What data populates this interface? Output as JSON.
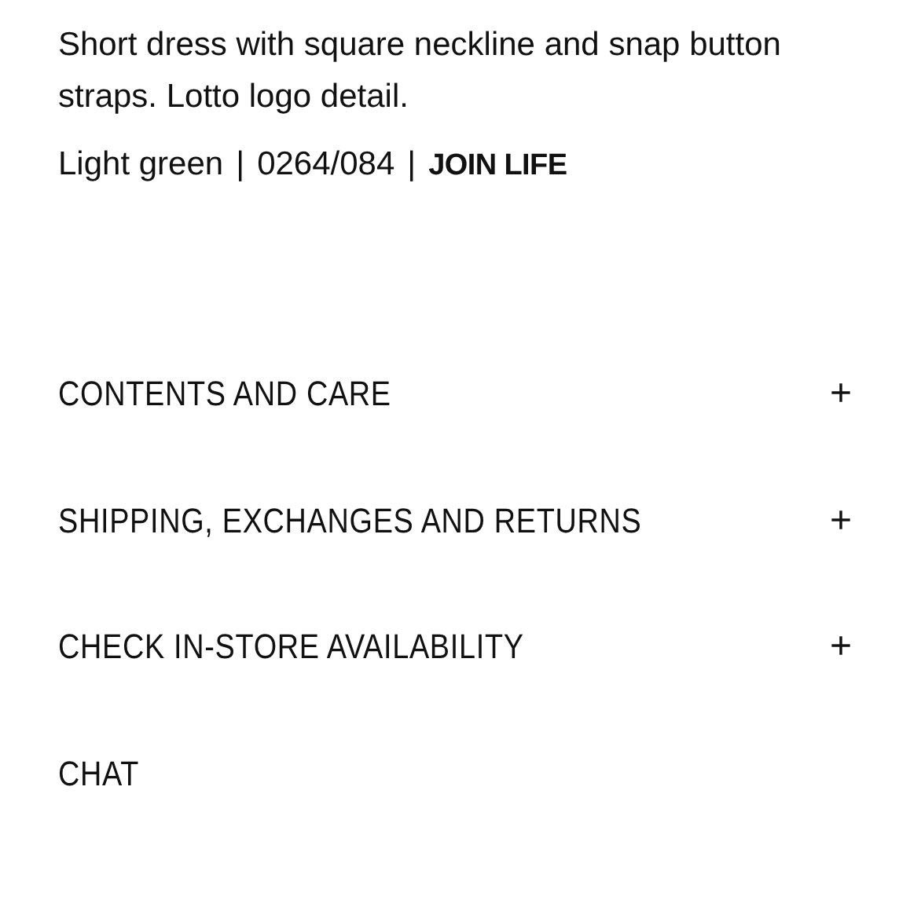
{
  "description": "Short dress with square neckline and snap button straps. Lotto logo detail.",
  "meta": {
    "variant": "Light green",
    "separator_1": "|",
    "reference": "0264/084",
    "separator_2": "|",
    "tag": "JOIN LIFE"
  },
  "sections": [
    {
      "label": "CONTENTS AND CARE",
      "toggle": "+"
    },
    {
      "label": "SHIPPING, EXCHANGES AND RETURNS",
      "toggle": "+"
    },
    {
      "label": "CHECK IN-STORE AVAILABILITY",
      "toggle": "+"
    },
    {
      "label": "CHAT"
    }
  ]
}
